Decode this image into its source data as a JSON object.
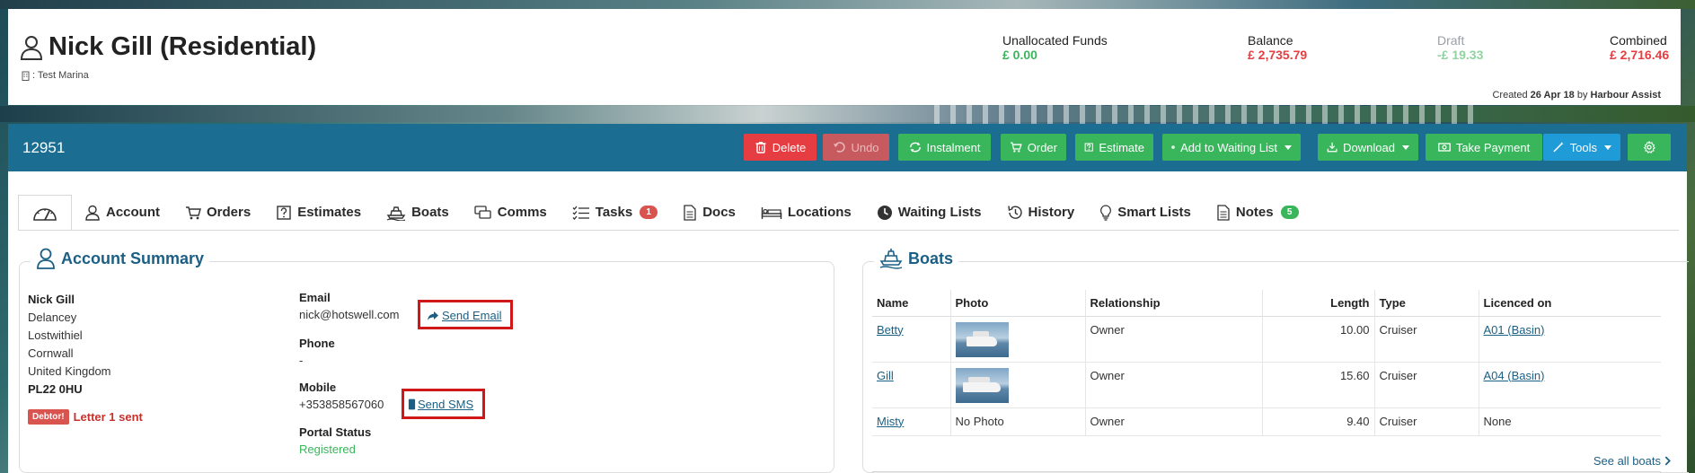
{
  "header": {
    "customer_name": "Nick Gill (Residential)",
    "marina_label": ": Test Marina",
    "funds": [
      {
        "label": "Unallocated Funds",
        "value": "£ 0.00",
        "color": "#39b65b"
      },
      {
        "label": "Balance",
        "value": "£ 2,735.79",
        "color": "#e53d41"
      },
      {
        "label": "Draft",
        "value": "-£ 19.33",
        "color": "#8fd4a0"
      },
      {
        "label": "Combined",
        "value": "£ 2,716.46",
        "color": "#e53d41"
      }
    ],
    "created_prefix": "Created",
    "created_date": "26 Apr 18",
    "created_by_word": "by",
    "created_by": "Harbour Assist"
  },
  "toolbar": {
    "record_id": "12951",
    "buttons": {
      "delete": "Delete",
      "undo": "Undo",
      "instalment": "Instalment",
      "order": "Order",
      "estimate": "Estimate",
      "add_waiting": "Add to Waiting List",
      "download": "Download",
      "take_payment": "Take Payment",
      "tools": "Tools"
    }
  },
  "tabs": [
    {
      "label": "Account"
    },
    {
      "label": "Orders"
    },
    {
      "label": "Estimates"
    },
    {
      "label": "Boats"
    },
    {
      "label": "Comms"
    },
    {
      "label": "Tasks",
      "count": "1",
      "count_color": "#d9534f"
    },
    {
      "label": "Docs"
    },
    {
      "label": "Locations"
    },
    {
      "label": "Waiting Lists"
    },
    {
      "label": "History"
    },
    {
      "label": "Smart Lists"
    },
    {
      "label": "Notes",
      "count": "5",
      "count_color": "#39b65b"
    }
  ],
  "account_summary": {
    "title": "Account Summary",
    "name": "Nick Gill",
    "address_lines": [
      "Delancey",
      "Lostwithiel",
      "Cornwall",
      "United Kingdom"
    ],
    "postcode": "PL22 0HU",
    "debtor_badge": "Debtor!",
    "debtor_text": "Letter 1 sent",
    "email_label": "Email",
    "email_value": "nick@hotswell.com",
    "send_email": "Send Email",
    "phone_label": "Phone",
    "phone_value": "-",
    "mobile_label": "Mobile",
    "mobile_value": "+353858567060",
    "send_sms": "Send SMS",
    "portal_label": "Portal Status",
    "portal_value": "Registered"
  },
  "boats": {
    "title": "Boats",
    "columns": [
      "Name",
      "Photo",
      "Relationship",
      "Length",
      "Type",
      "Licenced on"
    ],
    "rows": [
      {
        "name": "Betty",
        "photo": "",
        "relationship": "Owner",
        "length": "10.00",
        "type": "Cruiser",
        "licenced": "A01 (Basin)"
      },
      {
        "name": "Gill",
        "photo": "",
        "relationship": "Owner",
        "length": "15.60",
        "type": "Cruiser",
        "licenced": "A04 (Basin)"
      },
      {
        "name": "Misty",
        "photo": "No Photo",
        "relationship": "Owner",
        "length": "9.40",
        "type": "Cruiser",
        "licenced": "None"
      }
    ],
    "see_all": "See all boats"
  }
}
